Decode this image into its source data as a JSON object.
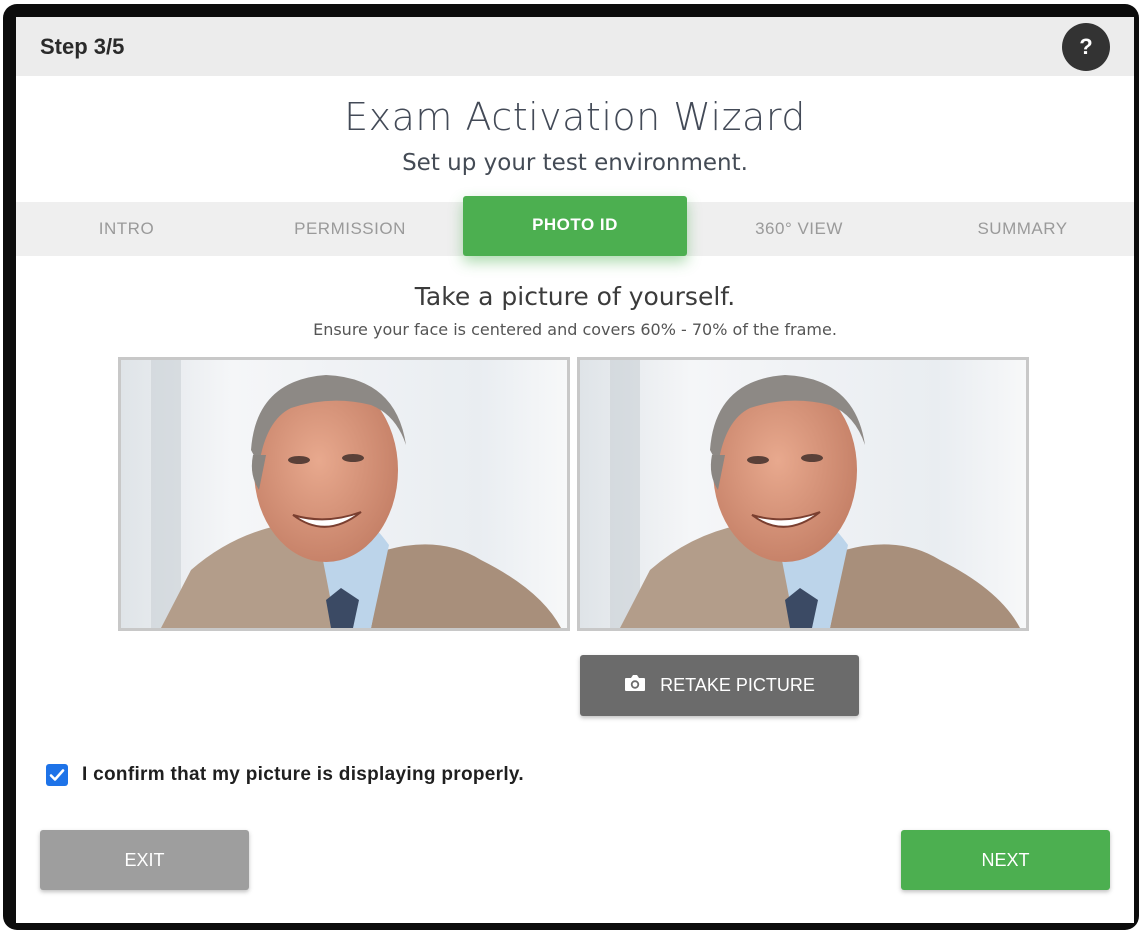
{
  "header": {
    "step": "Step 3/5",
    "help_icon": "help-circle-icon",
    "help_glyph": "?"
  },
  "wizard": {
    "title": "Exam Activation Wizard",
    "subtitle": "Set up your test environment."
  },
  "tabs": [
    {
      "label": "INTRO",
      "active": false
    },
    {
      "label": "PERMISSION",
      "active": false
    },
    {
      "label": "PHOTO ID",
      "active": true
    },
    {
      "label": "360° VIEW",
      "active": false
    },
    {
      "label": "SUMMARY",
      "active": false
    }
  ],
  "photo_step": {
    "instruction_title": "Take a picture of yourself.",
    "instruction_sub": "Ensure your face is centered and covers 60% - 70% of the frame.",
    "retake_label": "RETAKE PICTURE",
    "retake_icon": "camera-icon"
  },
  "confirm": {
    "label": "I confirm that my picture is displaying properly.",
    "checked": true
  },
  "footer": {
    "exit_label": "EXIT",
    "next_label": "NEXT"
  },
  "colors": {
    "accent_green": "#4caf50",
    "retake_gray": "#6b6b6b",
    "exit_gray": "#9e9e9e",
    "checkbox_blue": "#1e73e8"
  }
}
